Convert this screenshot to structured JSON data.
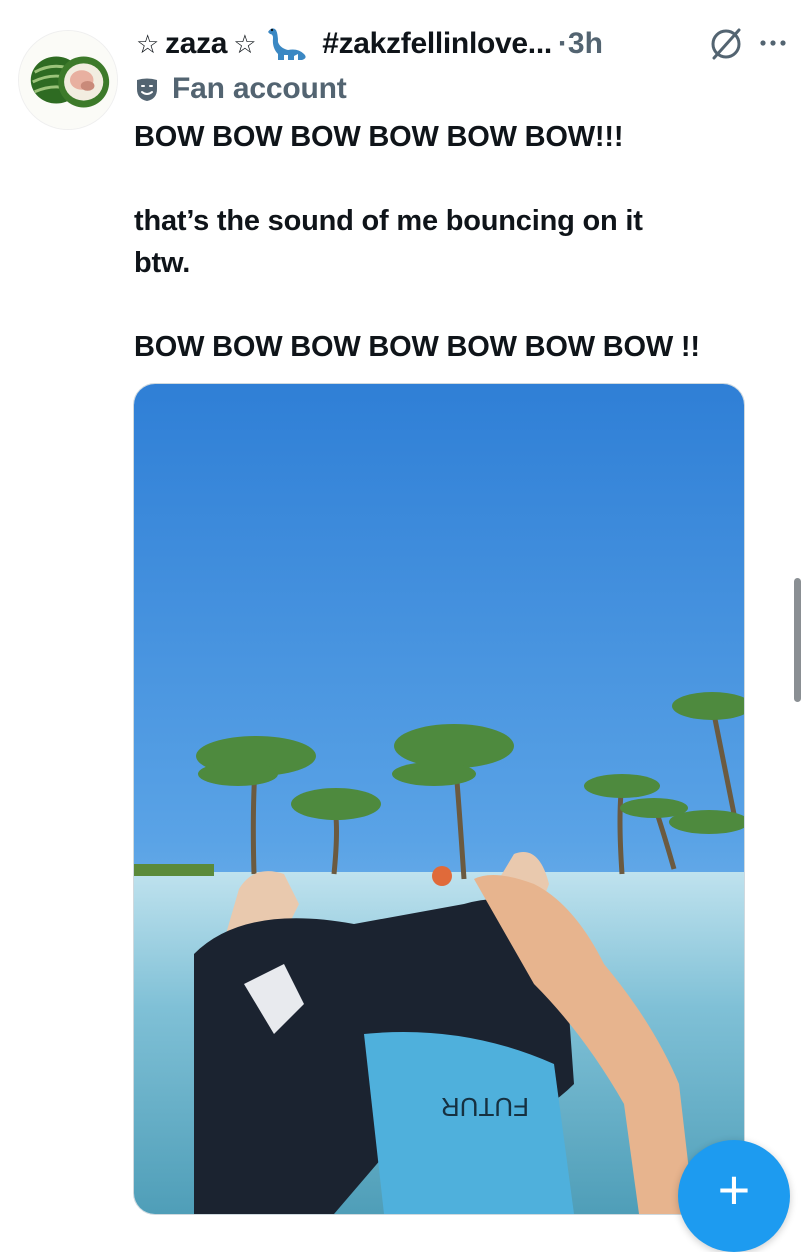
{
  "post": {
    "display_name": "zaza",
    "star_left": "☆",
    "star_right": "☆",
    "hashtag": "#zakzfellinlove...",
    "time": "·3h",
    "account_label": "Fan account",
    "text_lines": [
      "BOW BOW BOW BOW BOW BOW!!!",
      "that’s the sound of me bouncing on it",
      "btw.",
      "BOW BOW BOW BOW BOW BOW BOW !!"
    ],
    "media_overlay_text": "FUTUR"
  },
  "fab": {
    "label": "+"
  },
  "icons": {
    "avatar": "watermelon-avatar-icon",
    "emoji": "sauropod-emoji-icon",
    "grok": "grok-icon",
    "more": "more-options-icon",
    "mask": "theater-mask-icon"
  },
  "colors": {
    "text": "#0f1419",
    "muted": "#536471",
    "accent": "#1d9bf0"
  }
}
